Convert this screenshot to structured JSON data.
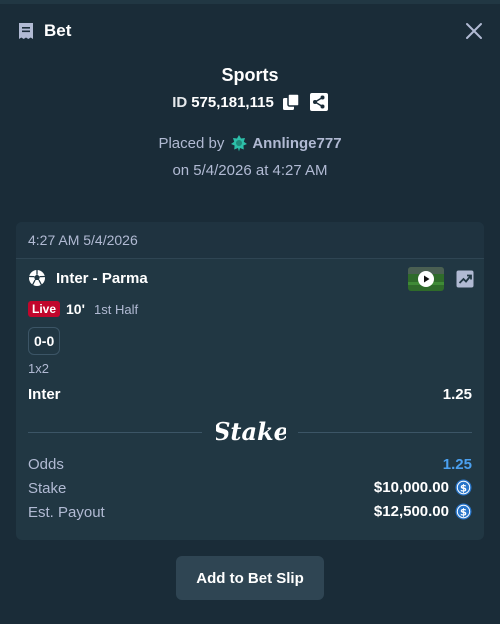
{
  "header": {
    "title": "Bet",
    "icons": {
      "bet": "receipt-icon",
      "close": "close-icon"
    }
  },
  "summary": {
    "category": "Sports",
    "id_prefix": "ID",
    "id_value": "575,181,115",
    "placed_by_label": "Placed by",
    "username": "Annlinge777",
    "date_line": "on 5/4/2026 at 4:27 AM",
    "icons": {
      "copy": "copy-icon",
      "share": "share-icon",
      "vip": "vip-badge-icon"
    }
  },
  "card": {
    "timestamp": "4:27 AM 5/4/2026",
    "match": "Inter - Parma",
    "live_label": "Live",
    "minute": "10'",
    "period": "1st Half",
    "score": "0-0",
    "market": "1x2",
    "selection": "Inter",
    "selection_odds": "1.25",
    "brand": "Stake",
    "rows": [
      {
        "label": "Odds",
        "value": "1.25"
      },
      {
        "label": "Stake",
        "value": "$10,000.00"
      },
      {
        "label": "Est. Payout",
        "value": "$12,500.00"
      }
    ],
    "icons": {
      "sport": "soccer-ball-icon",
      "stream": "video-thumbnail",
      "stats": "trend-chart-icon",
      "currency": "usd-coin-icon"
    }
  },
  "actions": {
    "add_to_slip": "Add to Bet Slip"
  },
  "colors": {
    "background": "#1a2c38",
    "card": "#213743",
    "accent_blue": "#4ba0f0",
    "live_red": "#c1062c",
    "muted_text": "#b1bad3",
    "button": "#2f4553"
  }
}
